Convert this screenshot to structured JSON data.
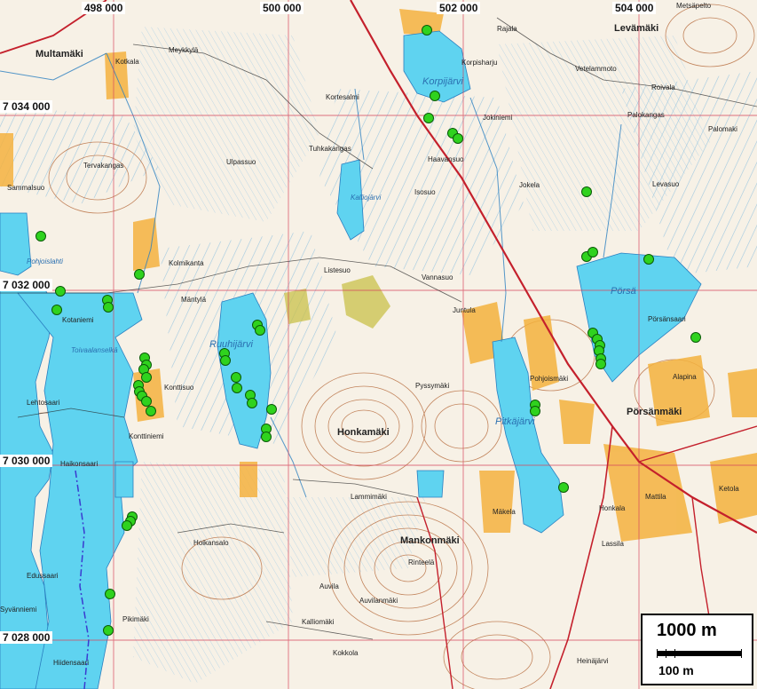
{
  "grid_labels": {
    "x": [
      "498 000",
      "500 000",
      "502 000",
      "504 000"
    ],
    "y": [
      "7 034 000",
      "7 032 000",
      "7 030 000",
      "7 028 000"
    ]
  },
  "places": [
    {
      "text": "Multamäki",
      "cls": "big"
    },
    {
      "text": "Levämäki",
      "cls": "big"
    },
    {
      "text": "Pörsänmäki",
      "cls": "big"
    },
    {
      "text": "Honkamäki",
      "cls": "big"
    },
    {
      "text": "Mankonmäki",
      "cls": "big"
    },
    {
      "text": "Korpijärvi",
      "cls": "big water"
    },
    {
      "text": "Pitkäjärvi",
      "cls": "big water"
    },
    {
      "text": "Pörsä",
      "cls": "big water"
    },
    {
      "text": "Ruuhijärvi",
      "cls": "big water"
    },
    {
      "text": "Toivaalanselkä",
      "cls": "water"
    },
    {
      "text": "Pohjoislahti",
      "cls": "water"
    },
    {
      "text": "Sammalsuo",
      "cls": ""
    },
    {
      "text": "Tervakangas",
      "cls": ""
    },
    {
      "text": "Ulpassuo",
      "cls": ""
    },
    {
      "text": "Tuhkakangas",
      "cls": ""
    },
    {
      "text": "Isosuo",
      "cls": ""
    },
    {
      "text": "Haavansuo",
      "cls": ""
    },
    {
      "text": "Kalliojärvi",
      "cls": "water"
    },
    {
      "text": "Listesuo",
      "cls": ""
    },
    {
      "text": "Vannasuo",
      "cls": ""
    },
    {
      "text": "Kolmikanta",
      "cls": ""
    },
    {
      "text": "Mäntylä",
      "cls": ""
    },
    {
      "text": "Kotaniemi",
      "cls": ""
    },
    {
      "text": "Konttisuo",
      "cls": ""
    },
    {
      "text": "Konttiniemi",
      "cls": ""
    },
    {
      "text": "Haikonsaari",
      "cls": ""
    },
    {
      "text": "Lehtosaari",
      "cls": ""
    },
    {
      "text": "Pyssymäki",
      "cls": ""
    },
    {
      "text": "Pohjoismäki",
      "cls": ""
    },
    {
      "text": "Juntula",
      "cls": ""
    },
    {
      "text": "Levasuo",
      "cls": ""
    },
    {
      "text": "Jokela",
      "cls": ""
    },
    {
      "text": "Jokiniemi",
      "cls": ""
    },
    {
      "text": "Korpisharju",
      "cls": ""
    },
    {
      "text": "Rajala",
      "cls": ""
    },
    {
      "text": "Vetelammoto",
      "cls": ""
    },
    {
      "text": "Roivala",
      "cls": ""
    },
    {
      "text": "Palokangas",
      "cls": ""
    },
    {
      "text": "Palomaki",
      "cls": ""
    },
    {
      "text": "Pörsänsaari",
      "cls": ""
    },
    {
      "text": "Lammimäki",
      "cls": ""
    },
    {
      "text": "Hoikansalo",
      "cls": ""
    },
    {
      "text": "Edussaari",
      "cls": ""
    },
    {
      "text": "Syvänniemi",
      "cls": ""
    },
    {
      "text": "Auvila",
      "cls": ""
    },
    {
      "text": "Auvilanmäki",
      "cls": ""
    },
    {
      "text": "Rinteelä",
      "cls": ""
    },
    {
      "text": "Kalliomäki",
      "cls": ""
    },
    {
      "text": "Hiidensaari",
      "cls": ""
    },
    {
      "text": "Heinäjärvi",
      "cls": ""
    },
    {
      "text": "Honkala",
      "cls": ""
    },
    {
      "text": "Mattila",
      "cls": ""
    },
    {
      "text": "Kokkola",
      "cls": ""
    },
    {
      "text": "Kotkala",
      "cls": ""
    },
    {
      "text": "Lassila",
      "cls": ""
    },
    {
      "text": "Ketola",
      "cls": ""
    },
    {
      "text": "Mäkela",
      "cls": ""
    },
    {
      "text": "Alapina",
      "cls": ""
    },
    {
      "text": "Meykkylä",
      "cls": ""
    },
    {
      "text": "Kortesalmi",
      "cls": ""
    },
    {
      "text": "Metsäpelto",
      "cls": ""
    },
    {
      "text": "Pikimäki",
      "cls": ""
    }
  ],
  "marker_count": 66,
  "scale_bar": {
    "major": "1000 m",
    "minor": "100 m"
  },
  "colors": {
    "marker_fill": "#2fd21e",
    "water": "#5fd3f0",
    "grid": "#d6455c",
    "road_main": "#c4202c",
    "contour": "#b5693a",
    "building_area": "#f4b23e"
  }
}
